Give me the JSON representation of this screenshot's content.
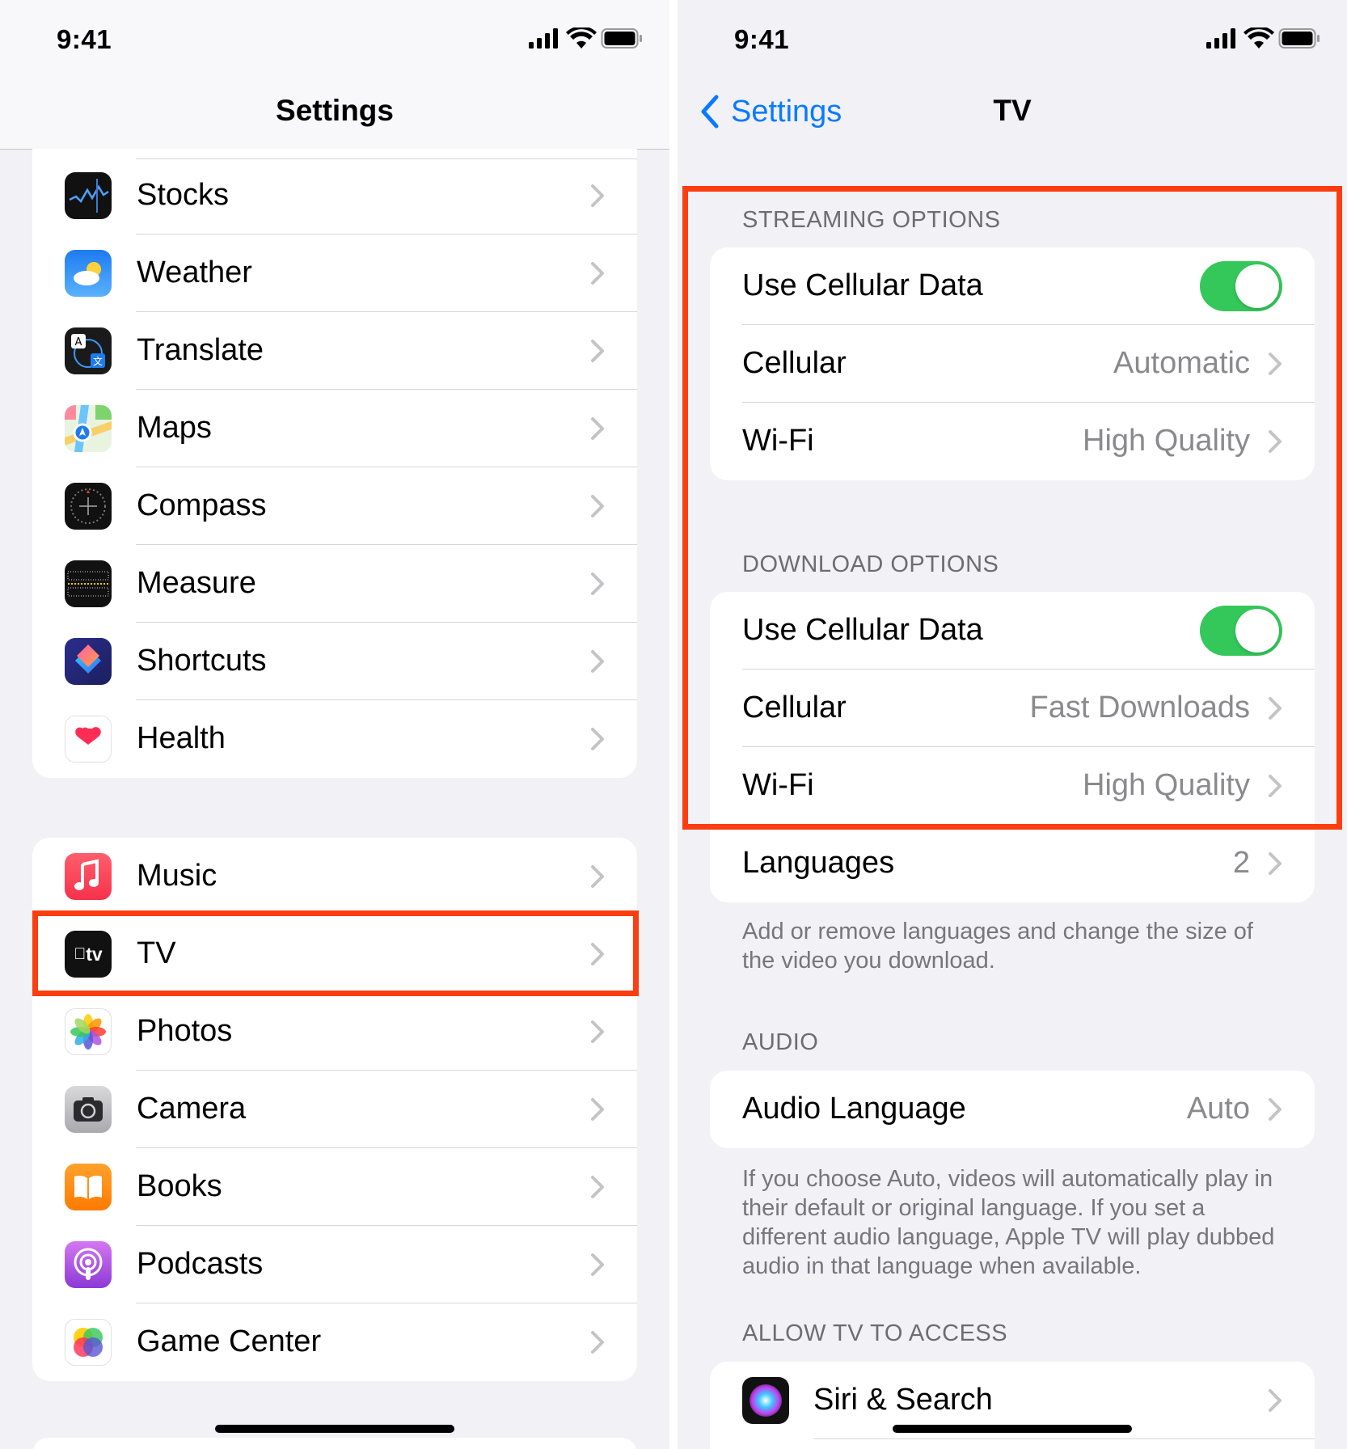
{
  "left": {
    "status": {
      "time": "9:41"
    },
    "title": "Settings",
    "group1": [
      {
        "label": "Stocks",
        "icon": "stocks-icon"
      },
      {
        "label": "Weather",
        "icon": "weather-icon"
      },
      {
        "label": "Translate",
        "icon": "translate-icon"
      },
      {
        "label": "Maps",
        "icon": "maps-icon"
      },
      {
        "label": "Compass",
        "icon": "compass-icon"
      },
      {
        "label": "Measure",
        "icon": "measure-icon"
      },
      {
        "label": "Shortcuts",
        "icon": "shortcuts-icon"
      },
      {
        "label": "Health",
        "icon": "health-icon"
      }
    ],
    "group2": [
      {
        "label": "Music",
        "icon": "music-icon"
      },
      {
        "label": "TV",
        "icon": "tv-icon"
      },
      {
        "label": "Photos",
        "icon": "photos-icon"
      },
      {
        "label": "Camera",
        "icon": "camera-icon"
      },
      {
        "label": "Books",
        "icon": "books-icon"
      },
      {
        "label": "Podcasts",
        "icon": "podcasts-icon"
      },
      {
        "label": "Game Center",
        "icon": "game-center-icon"
      }
    ],
    "tv_icon_text": "tv"
  },
  "right": {
    "status": {
      "time": "9:41"
    },
    "back_label": "Settings",
    "title": "TV",
    "streaming": {
      "header": "STREAMING OPTIONS",
      "use_cellular": {
        "label": "Use Cellular Data",
        "on": true
      },
      "cellular": {
        "label": "Cellular",
        "value": "Automatic"
      },
      "wifi": {
        "label": "Wi-Fi",
        "value": "High Quality"
      }
    },
    "download": {
      "header": "DOWNLOAD OPTIONS",
      "use_cellular": {
        "label": "Use Cellular Data",
        "on": true
      },
      "cellular": {
        "label": "Cellular",
        "value": "Fast Downloads"
      },
      "wifi": {
        "label": "Wi-Fi",
        "value": "High Quality"
      },
      "languages": {
        "label": "Languages",
        "value": "2"
      },
      "footer": "Add or remove languages and change the size of the video you download."
    },
    "audio": {
      "header": "AUDIO",
      "audio_language": {
        "label": "Audio Language",
        "value": "Auto"
      },
      "footer": "If you choose Auto, videos will automatically play in their default or original language. If you set a different audio language, Apple TV will play dubbed audio in that language when available."
    },
    "access": {
      "header": "ALLOW TV TO ACCESS",
      "siri": {
        "label": "Siri & Search",
        "icon": "siri-icon"
      }
    }
  },
  "colors": {
    "accent": "#0a7aff",
    "toggle_on": "#34c759",
    "highlight": "#fb3d10"
  }
}
